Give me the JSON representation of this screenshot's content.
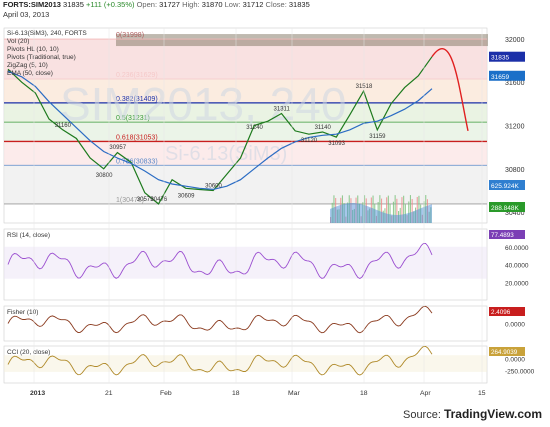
{
  "header": {
    "symbol": "FORTS:SIM2013",
    "last": "31835",
    "change": "+111 (+0.35%)",
    "open_label": "Open:",
    "open": "31727",
    "high_label": "High:",
    "high": "31870",
    "low_label": "Low:",
    "low": "31712",
    "close_label": "Close:",
    "close": "31835",
    "date": "April 03, 2013"
  },
  "main_panel": {
    "legend": [
      "Si-6.13(SiM3), 240, FORTS",
      "Vol (20)",
      "Pivots HL (10, 10)",
      "Pivots (Traditional, true)",
      "ZigZag (5, 10)",
      "EMA (50, close)"
    ],
    "watermark": "SIM2013, 240",
    "watermark2": "Si-6.13(SiM3)",
    "price_ticks": [
      "32000",
      "31600",
      "31200",
      "30800",
      "30400"
    ],
    "fib_levels": [
      {
        "label": "0(31998)",
        "value": 31998,
        "color": "#f2b8b8"
      },
      {
        "label": "0.236(31629)",
        "value": 31629,
        "color": "#f5c9c9"
      },
      {
        "label": "0.382(31409)",
        "value": 31409,
        "color": "#1b2fa8"
      },
      {
        "label": "0.5(31231)",
        "value": 31231,
        "color": "#3a9a3a"
      },
      {
        "label": "0.618(31053)",
        "value": 31053,
        "color": "#c81e1e"
      },
      {
        "label": "0.786(30833)",
        "value": 30833,
        "color": "#5a88c8"
      },
      {
        "label": "1(30476)",
        "value": 30476,
        "color": "#999999"
      }
    ],
    "pivot_labels": [
      {
        "text": "31160",
        "value": 31160
      },
      {
        "text": "30800",
        "value": 30800
      },
      {
        "text": "30957",
        "value": 30957
      },
      {
        "text": "30579",
        "value": 30579
      },
      {
        "text": "30476",
        "value": 30476
      },
      {
        "text": "30609",
        "value": 30609
      },
      {
        "text": "30600",
        "value": 30600
      },
      {
        "text": "31240",
        "value": 31240
      },
      {
        "text": "31311",
        "value": 31311
      },
      {
        "text": "31120",
        "value": 31120
      },
      {
        "text": "31140",
        "value": 31140
      },
      {
        "text": "31093",
        "value": 31093
      },
      {
        "text": "31518",
        "value": 31518
      },
      {
        "text": "31159",
        "value": 31159
      }
    ],
    "price_badges": [
      {
        "text": "31835",
        "color": "#1b2fa8"
      },
      {
        "text": "31659",
        "color": "#1b6fc8"
      },
      {
        "text": "625.924K",
        "color": "#2f7fd0"
      },
      {
        "text": "288.848K",
        "color": "#2a9a2a"
      }
    ]
  },
  "rsi_panel": {
    "label": "RSI (14, close)",
    "ticks": [
      "60.0000",
      "40.0000",
      "20.0000"
    ],
    "badge": "77.4893"
  },
  "fisher_panel": {
    "label": "Fisher (10)",
    "ticks": [
      "0.0000"
    ],
    "badge": "2.4096"
  },
  "cci_panel": {
    "label": "CCI (20, close)",
    "ticks": [
      "0.0000",
      "-250.0000"
    ],
    "badge": "264.9039"
  },
  "time_axis": [
    "2013",
    "21",
    "Feb",
    "18",
    "Mar",
    "18",
    "Apr",
    "15"
  ],
  "footer": {
    "source": "Source:",
    "brand": "TradingView.com"
  },
  "chart_data": {
    "type": "line",
    "title": "Si-6.13(SiM3), 240, FORTS",
    "x": [
      "2013",
      "21",
      "Feb",
      "18",
      "Mar",
      "18",
      "Apr",
      "15"
    ],
    "ylim": [
      30300,
      32100
    ],
    "series": [
      {
        "name": "Si-6.13(SiM3)",
        "values": [
          31720,
          31600,
          31500,
          31260,
          31160,
          31080,
          30900,
          30800,
          30950,
          30860,
          30580,
          30476,
          30700,
          30620,
          30609,
          30600,
          30750,
          30900,
          31200,
          31240,
          31311,
          31150,
          31120,
          31140,
          31093,
          31300,
          31518,
          31159,
          31400,
          31550,
          31659,
          31835
        ]
      },
      {
        "name": "EMA (50, close)",
        "values": [
          31700,
          31650,
          31560,
          31420,
          31300,
          31180,
          31060,
          30960,
          30900,
          30850,
          30780,
          30700,
          30660,
          30640,
          30620,
          30610,
          30640,
          30700,
          30800,
          30900,
          30990,
          31050,
          31090,
          31110,
          31120,
          31160,
          31220,
          31240,
          31290,
          31350,
          31430,
          31540
        ]
      }
    ],
    "fibonacci": [
      31998,
      31629,
      31409,
      31231,
      31053,
      30833,
      30476
    ],
    "rsi": {
      "range": [
        20,
        80
      ],
      "last": 77.4893
    },
    "fisher": {
      "last": 2.4096
    },
    "cci": {
      "last": 264.9039
    }
  }
}
